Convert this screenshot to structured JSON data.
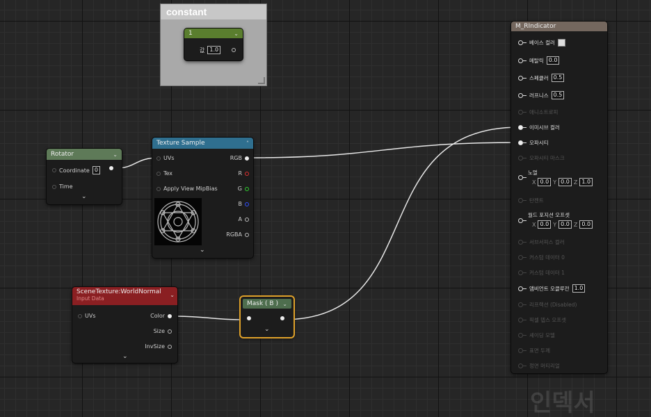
{
  "comment": {
    "title": "constant"
  },
  "constant_node": {
    "title": "1",
    "value_label": "값",
    "value": "1.0"
  },
  "rotator": {
    "title": "Rotator",
    "coordinate_label": "Coordinate",
    "coordinate_value": "0",
    "time_label": "Time"
  },
  "texture_sample": {
    "title": "Texture Sample",
    "inputs": [
      "UVs",
      "Tex",
      "Apply View MipBias"
    ],
    "outputs": [
      "RGB",
      "R",
      "G",
      "B",
      "A",
      "RGBA"
    ]
  },
  "scene_texture": {
    "title": "SceneTexture:WorldNormal",
    "subtitle": "Input Data",
    "input": "UVs",
    "outputs": [
      "Color",
      "Size",
      "InvSize"
    ]
  },
  "mask": {
    "title": "Mask ( B )"
  },
  "material": {
    "title": "M_RIndicator",
    "base_color_label": "베이스 컬러",
    "metallic_label": "메탈릭",
    "metallic_value": "0.0",
    "specular_label": "스페큘러",
    "specular_value": "0.5",
    "roughness_label": "러프니스",
    "roughness_value": "0.5",
    "anisotropy_label": "애니소트로피",
    "emissive_label": "이미시브 컬러",
    "opacity_label": "오파시티",
    "opacity_mask_label": "오파시티 마스크",
    "normal_label": "노멀",
    "normal_x": "0.0",
    "normal_y": "0.0",
    "normal_z": "1.0",
    "tangent_label": "탄젠트",
    "wpo_label": "월드 포지션 오프셋",
    "wpo_x": "0.0",
    "wpo_y": "0.0",
    "wpo_z": "0.0",
    "subsurface_label": "서브서피스 컬러",
    "custom0_label": "커스텀 데이터 0",
    "custom1_label": "커스텀 데이터 1",
    "ao_label": "앰비언트 오클루전",
    "ao_value": "1.0",
    "refraction_label": "리프랙션 (Disabled)",
    "pdo_label": "픽셀 뎁스 오프셋",
    "shading_model_label": "셰이딩 모델",
    "surface_thickness_label": "표면 두께",
    "front_material_label": "정면 머티리얼",
    "axis_x": "X",
    "axis_y": "Y",
    "axis_z": "Z"
  },
  "watermark": "인덱서",
  "colors": {
    "rotator_header": "#5e7a58",
    "texture_header": "#2f6f8f",
    "scene_header": "#8a1f22",
    "mask_header": "#4e6e4e",
    "constant_header": "#5a7e2e",
    "material_header": "#74675e",
    "mask_border": "#e0a22a"
  }
}
